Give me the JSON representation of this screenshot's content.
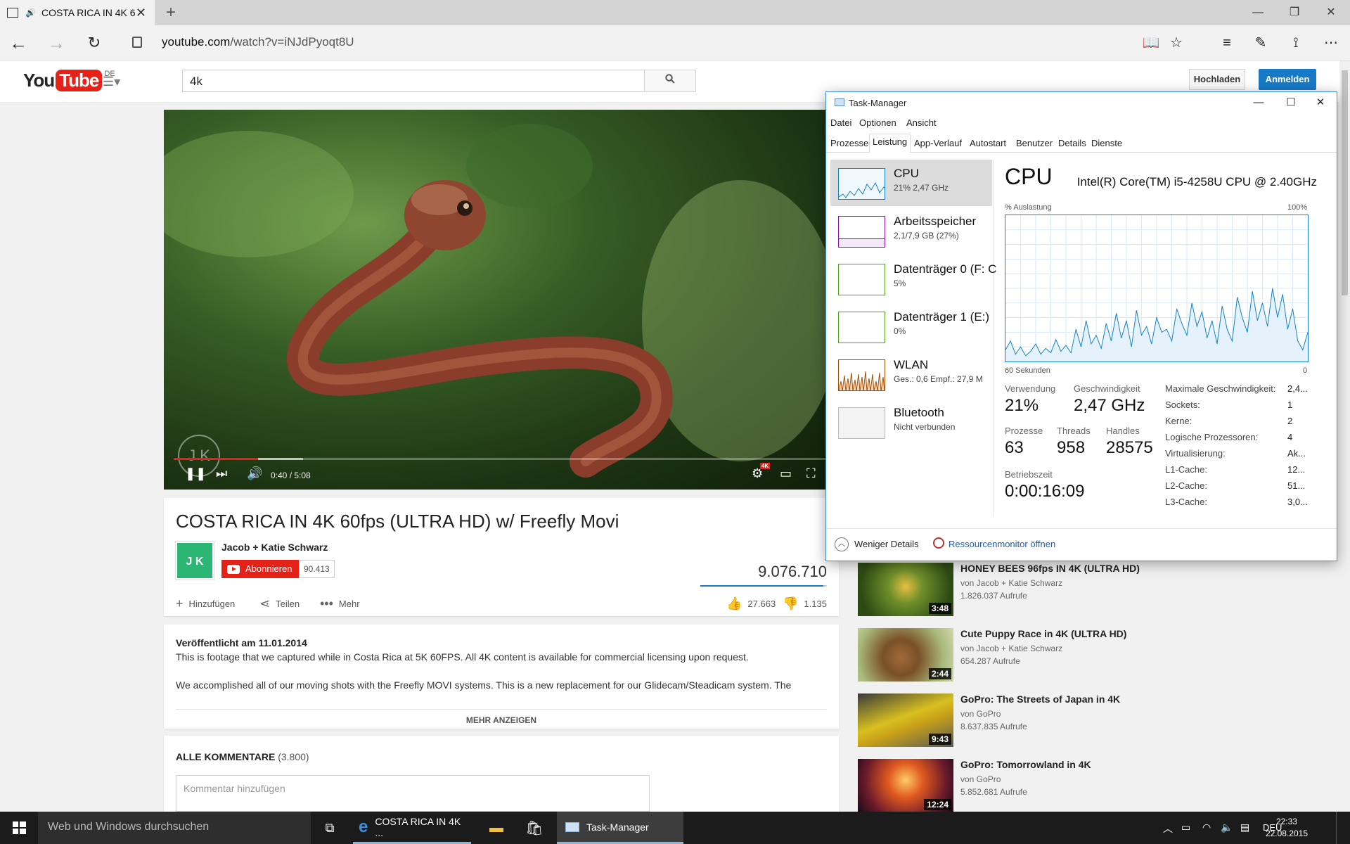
{
  "browser": {
    "tab_title": "COSTA RICA IN 4K 6",
    "url_host": "youtube.com",
    "url_path": "/watch?v=iNJdPyoqt8U"
  },
  "youtube": {
    "logo_you": "You",
    "logo_tube": "Tube",
    "logo_region": "DE",
    "search_value": "4k",
    "upload_label": "Hochladen",
    "signin_label": "Anmelden",
    "video": {
      "time": "0:40 / 5:08",
      "progress_fraction": 0.13,
      "watermark": "J K",
      "hd_badge": "4K"
    },
    "title": "COSTA RICA IN 4K 60fps (ULTRA HD) w/ Freefly Movi",
    "channel_name": "Jacob + Katie Schwarz",
    "channel_logo": "J K",
    "subscribe_label": "Abonnieren",
    "subscriber_count": "90.413",
    "views": "9.076.710",
    "add_label": "Hinzufügen",
    "share_label": "Teilen",
    "more_label": "Mehr",
    "likes": "27.663",
    "dislikes": "1.135",
    "published": "Veröffentlicht am 11.01.2014",
    "desc_line1": "This is footage that we captured while in Costa Rica at 5K 60FPS. All 4K content is available for commercial licensing upon request.",
    "desc_line2": "We accomplished all of our moving shots with the Freefly MOVI systems. This is a new replacement for our Glidecam/Steadicam system. The",
    "show_more": "MEHR ANZEIGEN",
    "comments_title": "ALLE KOMMENTARE",
    "comments_count": "(3.800)",
    "comment_placeholder": "Kommentar hinzufügen",
    "related": [
      {
        "title": "HONEY BEES 96fps IN 4K (ULTRA HD)",
        "author": "von Jacob + Katie Schwarz",
        "views": "1.826.037 Aufrufe",
        "duration": "3:48"
      },
      {
        "title": "Cute Puppy Race in 4K (ULTRA HD)",
        "author": "von Jacob + Katie Schwarz",
        "views": "654.287 Aufrufe",
        "duration": "2:44"
      },
      {
        "title": "GoPro: The Streets of Japan in 4K",
        "author": "von GoPro",
        "views": "8.637.835 Aufrufe",
        "duration": "9:43"
      },
      {
        "title": "GoPro: Tomorrowland in 4K",
        "author": "von GoPro",
        "views": "5.852.681 Aufrufe",
        "duration": "12:24"
      }
    ]
  },
  "taskmanager": {
    "title": "Task-Manager",
    "menu": [
      "Datei",
      "Optionen",
      "Ansicht"
    ],
    "tabs": [
      "Prozesse",
      "Leistung",
      "App-Verlauf",
      "Autostart",
      "Benutzer",
      "Details",
      "Dienste"
    ],
    "active_tab": "Leistung",
    "resources": [
      {
        "name": "CPU",
        "sub": "21%  2,47 GHz"
      },
      {
        "name": "Arbeitsspeicher",
        "sub": "2,1/7,9 GB (27%)"
      },
      {
        "name": "Datenträger 0 (F: C",
        "sub": "5%"
      },
      {
        "name": "Datenträger 1 (E:)",
        "sub": "0%"
      },
      {
        "name": "WLAN",
        "sub": "Ges.: 0,6  Empf.: 27,9 M"
      },
      {
        "name": "Bluetooth",
        "sub": "Nicht verbunden"
      }
    ],
    "cpu_heading": "CPU",
    "cpu_model": "Intel(R) Core(TM) i5-4258U CPU @ 2.40GHz",
    "axis_top_left": "% Auslastung",
    "axis_top_right": "100%",
    "axis_bottom_left": "60 Sekunden",
    "axis_bottom_right": "0",
    "cpu_usage_series": [
      8,
      14,
      5,
      10,
      4,
      7,
      12,
      5,
      9,
      6,
      15,
      7,
      11,
      6,
      22,
      10,
      28,
      12,
      18,
      9,
      26,
      14,
      33,
      16,
      28,
      10,
      35,
      18,
      24,
      12,
      30,
      20,
      22,
      14,
      36,
      26,
      18,
      40,
      24,
      34,
      16,
      28,
      12,
      38,
      22,
      14,
      44,
      30,
      20,
      48,
      28,
      40,
      24,
      50,
      30,
      46,
      22,
      36,
      14,
      8,
      20
    ],
    "stats": {
      "usage_label": "Verwendung",
      "usage": "21%",
      "speed_label": "Geschwindigkeit",
      "speed": "2,47 GHz",
      "proc_label": "Prozesse",
      "proc": "63",
      "threads_label": "Threads",
      "threads": "958",
      "handles_label": "Handles",
      "handles": "28575",
      "uptime_label": "Betriebszeit",
      "uptime": "0:00:16:09"
    },
    "specs": [
      {
        "label": "Maximale Geschwindigkeit:",
        "value": "2,4..."
      },
      {
        "label": "Sockets:",
        "value": "1"
      },
      {
        "label": "Kerne:",
        "value": "2"
      },
      {
        "label": "Logische Prozessoren:",
        "value": "4"
      },
      {
        "label": "Virtualisierung:",
        "value": "Ak..."
      },
      {
        "label": "L1-Cache:",
        "value": "12..."
      },
      {
        "label": "L2-Cache:",
        "value": "51..."
      },
      {
        "label": "L3-Cache:",
        "value": "3,0..."
      }
    ],
    "fewer_details": "Weniger Details",
    "resource_monitor": "Ressourcenmonitor öffnen"
  },
  "taskbar": {
    "search_placeholder": "Web und Windows durchsuchen",
    "edge_label": "COSTA RICA IN 4K ...",
    "tm_label": "Task-Manager",
    "lang": "DEU",
    "time": "22:33",
    "date": "22.08.2015"
  },
  "colors": {
    "youtube_red": "#e62117",
    "youtube_blue": "#167ac6",
    "cpu_graph": "#1183c7",
    "memory": "#8b12ae",
    "disk": "#4da60c",
    "network": "#a74f01"
  }
}
